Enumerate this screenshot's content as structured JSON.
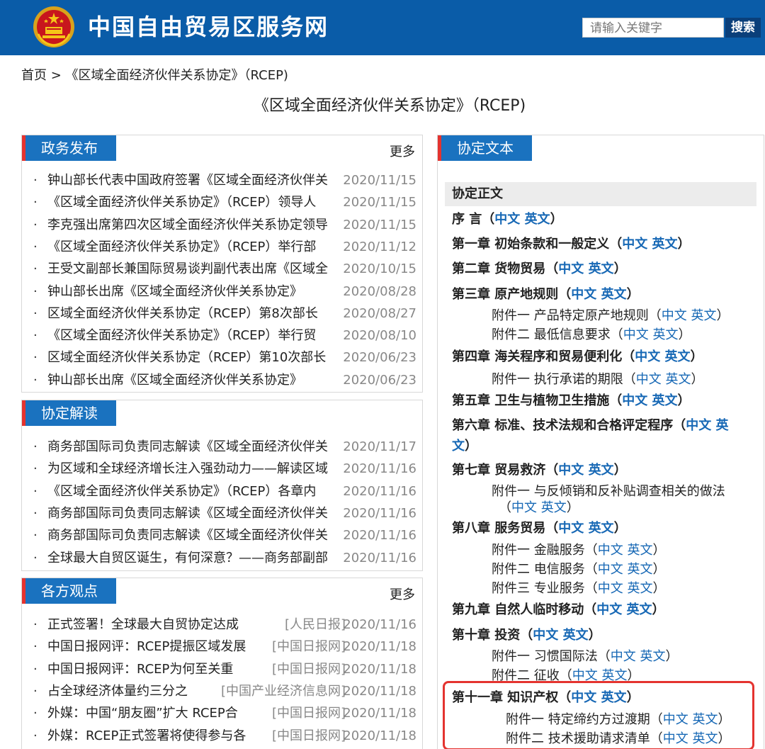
{
  "header": {
    "site_title": "中国自由贸易区服务网",
    "search_placeholder": "请输入关键字",
    "search_button": "搜索"
  },
  "breadcrumb": "首页 > 《区域全面经济伙伴关系协定》（RCEP)",
  "page_title": "《区域全面经济伙伴关系协定》（RCEP)",
  "panels": {
    "policy": {
      "title": "政务发布",
      "more": "更多",
      "items": [
        {
          "title": "钟山部长代表中国政府签署《区域全面经济伙伴关",
          "date": "2020/11/15"
        },
        {
          "title": "《区域全面经济伙伴关系协定》（RCEP）领导人",
          "date": "2020/11/15"
        },
        {
          "title": "李克强出席第四次区域全面经济伙伴关系协定领导",
          "date": "2020/11/15"
        },
        {
          "title": "《区域全面经济伙伴关系协定》（RCEP）举行部",
          "date": "2020/11/12"
        },
        {
          "title": "王受文副部长兼国际贸易谈判副代表出席《区域全",
          "date": "2020/10/15"
        },
        {
          "title": "钟山部长出席《区域全面经济伙伴关系协定》",
          "date": "2020/08/28"
        },
        {
          "title": "区域全面经济伙伴关系协定（RCEP）第8次部长",
          "date": "2020/08/27"
        },
        {
          "title": "《区域全面经济伙伴关系协定》（RCEP）举行贸",
          "date": "2020/08/10"
        },
        {
          "title": "区域全面经济伙伴关系协定（RCEP）第10次部长",
          "date": "2020/06/23"
        },
        {
          "title": "钟山部长出席《区域全面经济伙伴关系协定》",
          "date": "2020/06/23"
        }
      ]
    },
    "interpretation": {
      "title": "协定解读",
      "items": [
        {
          "title": "商务部国际司负责同志解读《区域全面经济伙伴关",
          "date": "2020/11/17"
        },
        {
          "title": "为区域和全球经济增长注入强劲动力——解读区域",
          "date": "2020/11/16"
        },
        {
          "title": "《区域全面经济伙伴关系协定》（RCEP）各章内",
          "date": "2020/11/16"
        },
        {
          "title": "商务部国际司负责同志解读《区域全面经济伙伴关",
          "date": "2020/11/16"
        },
        {
          "title": "商务部国际司负责同志解读《区域全面经济伙伴关",
          "date": "2020/11/16"
        },
        {
          "title": "全球最大自贸区诞生，有何深意？——商务部副部",
          "date": "2020/11/16"
        }
      ]
    },
    "opinions": {
      "title": "各方观点",
      "more": "更多",
      "items": [
        {
          "title": "正式签署！全球最大自贸协定达成",
          "source": "[人民日报]",
          "date": "2020/11/16"
        },
        {
          "title": "中国日报网评：RCEP提振区域发展",
          "source": "[中国日报网]",
          "date": "2020/11/18"
        },
        {
          "title": "中国日报网评：RCEP为何至关重",
          "source": "[中国日报网]",
          "date": "2020/11/18"
        },
        {
          "title": "占全球经济体量约三分之",
          "source": "[中国产业经济信息网]",
          "date": "2020/11/18"
        },
        {
          "title": "外媒：中国“朋友圈”扩大 RCEP合",
          "source": "[中国日报网]",
          "date": "2020/11/18"
        },
        {
          "title": "外媒：RCEP正式签署将使得参与各",
          "source": "[中国日报网]",
          "date": "2020/11/18"
        }
      ]
    }
  },
  "doc_panel": {
    "title": "协定文本",
    "subtitle": "协定正文",
    "cn": "中文",
    "en": "英文",
    "lines": {
      "preface": "序 言（",
      "ch1": "第一章 初始条款和一般定义（",
      "ch2": "第二章 货物贸易（",
      "ch3": "第三章 原产地规则（",
      "ch3_a1": "附件一 产品特定原产地规则（",
      "ch3_a2": "附件二 最低信息要求（",
      "ch4": "第四章 海关程序和贸易便利化（",
      "ch4_a1": "附件一 执行承诺的期限（",
      "ch5": "第五章 卫生与植物卫生措施（",
      "ch6": "第六章 标准、技术法规和合格评定程序（",
      "ch6_en1": "英",
      "ch6_en2": "文",
      "ch7": "第七章 贸易救济（",
      "ch7_a1": "附件一 与反倾销和反补贴调查相关的做法",
      "ch8": "第八章 服务贸易（",
      "ch8_a1": "附件一 金融服务（",
      "ch8_a2": "附件二 电信服务（",
      "ch8_a3": "附件三 专业服务（",
      "ch9": "第九章 自然人临时移动（",
      "ch10": "第十章 投资（",
      "ch10_a1": "附件一 习惯国际法（",
      "ch10_a2": "附件二 征收（",
      "ch11": "第十一章 知识产权（",
      "ch11_a1": "附件一 特定缔约方过渡期（",
      "ch11_a2": "附件二 技术援助请求清单（",
      "close": "）",
      "open": "（"
    }
  },
  "colors": {
    "header_bg": "#0a5ca8",
    "tab_bg": "#1a72bf",
    "tab_accent": "#e4332f",
    "link": "#1768b5",
    "highlight": "#e4332f"
  }
}
